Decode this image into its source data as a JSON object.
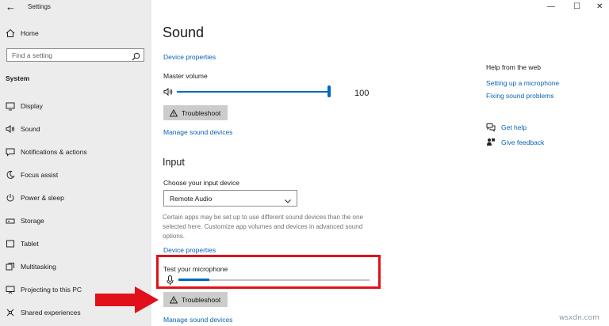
{
  "window": {
    "title": "Settings",
    "back_glyph": "←",
    "minimize_glyph": "—",
    "maximize_glyph": "☐",
    "close_glyph": "✕"
  },
  "sidebar": {
    "home_label": "Home",
    "search_placeholder": "Find a setting",
    "section_label": "System",
    "items": [
      {
        "label": "Display",
        "icon": "monitor-icon"
      },
      {
        "label": "Sound",
        "icon": "speaker-icon"
      },
      {
        "label": "Notifications & actions",
        "icon": "message-icon"
      },
      {
        "label": "Focus assist",
        "icon": "moon-icon"
      },
      {
        "label": "Power & sleep",
        "icon": "power-icon"
      },
      {
        "label": "Storage",
        "icon": "drive-icon"
      },
      {
        "label": "Tablet",
        "icon": "tablet-icon"
      },
      {
        "label": "Multitasking",
        "icon": "multitask-icon"
      },
      {
        "label": "Projecting to this PC",
        "icon": "project-icon"
      },
      {
        "label": "Shared experiences",
        "icon": "shared-icon"
      }
    ]
  },
  "main": {
    "title": "Sound",
    "output": {
      "device_properties_link": "Device properties",
      "master_volume_label": "Master volume",
      "volume_value": "100",
      "volume_level": 1.0,
      "troubleshoot_label": "Troubleshoot",
      "manage_devices_link": "Manage sound devices"
    },
    "input": {
      "heading": "Input",
      "choose_label": "Choose your input device",
      "selected_device": "Remote Audio",
      "help_text": "Certain apps may be set up to use different sound devices than the one selected here. Customize app volumes and devices in advanced sound options.",
      "device_properties_link": "Device properties",
      "test_mic_label": "Test your microphone",
      "mic_level": 0.16,
      "troubleshoot_label": "Troubleshoot",
      "manage_devices_link": "Manage sound devices"
    }
  },
  "right_panel": {
    "heading": "Help from the web",
    "links": [
      "Setting up a microphone",
      "Fixing sound problems"
    ],
    "get_help": "Get help",
    "give_feedback": "Give feedback"
  },
  "watermark": "wsxdn.com",
  "colors": {
    "accent": "#0067c0",
    "link": "#0a63b3",
    "highlight_box": "#e0111a",
    "arrow": "#e0111a",
    "sidebar_bg": "#ececec",
    "button_bg": "#cccccc"
  }
}
